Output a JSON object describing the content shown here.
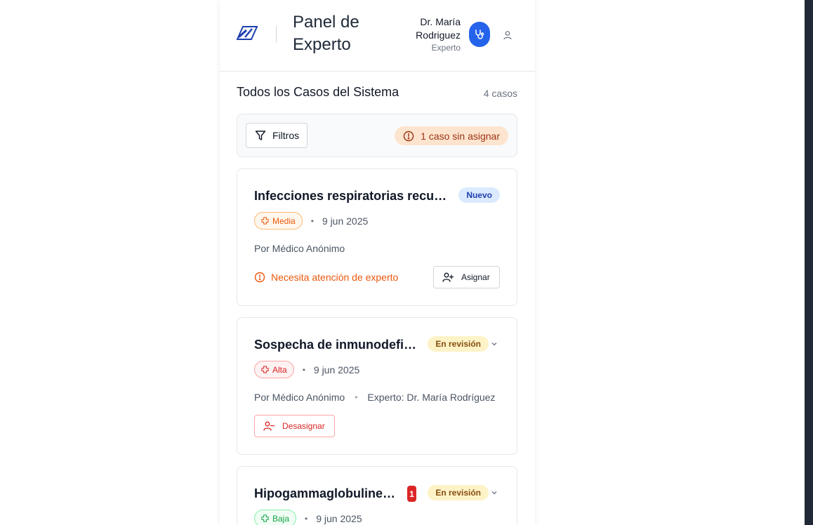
{
  "header": {
    "title": "Panel de Experto",
    "user_name": "Dr. María Rodriguez",
    "user_role": "Experto"
  },
  "section": {
    "title": "Todos los Casos del Sistema",
    "count": "4 casos"
  },
  "filters": {
    "button_label": "Filtros",
    "unassigned_label": "1 caso sin asignar"
  },
  "cases": [
    {
      "title": "Infecciones respiratorias recu…",
      "status": "Nuevo",
      "priority": "Media",
      "date": "9 jun 2025",
      "author": "Por Médico Anónimo",
      "attention": "Necesita atención de experto",
      "action": "Asignar"
    },
    {
      "title": "Sospecha de inmunodefi…",
      "status": "En revisión",
      "priority": "Alta",
      "date": "9 jun 2025",
      "author": "Por Médico Anónimo",
      "expert": "Experto: Dr. María Rodríguez",
      "action": "Desasignar"
    },
    {
      "title": "Hipogammaglobuline…",
      "unread": "1",
      "status": "En revisión",
      "priority": "Baja",
      "date": "9 jun 2025"
    }
  ],
  "colors": {
    "primary": "#2563eb",
    "warning": "#ea580c",
    "danger": "#dc2626",
    "success": "#16a34a"
  }
}
